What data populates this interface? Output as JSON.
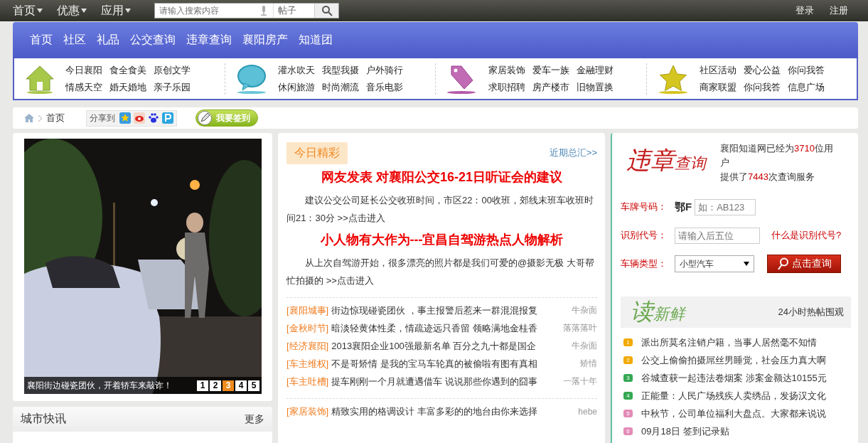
{
  "top_nav": [
    {
      "label": "首页"
    },
    {
      "label": "优惠"
    },
    {
      "label": "应用"
    }
  ],
  "search": {
    "placeholder": "请输入搜索内容",
    "scope": "帖子"
  },
  "account_links": [
    "登录",
    "注册"
  ],
  "main_nav": [
    "首页",
    "社区",
    "礼品",
    "公交查询",
    "违章查询",
    "襄阳房产",
    "知道团"
  ],
  "categories": [
    {
      "kind": "house",
      "links": [
        "今日襄阳",
        "食全食美",
        "原创文学",
        "情感天空",
        "婚天婚地",
        "亲子乐园"
      ]
    },
    {
      "kind": "bubble",
      "links": [
        "灌水吹天",
        "我型我摄",
        "户外骑行",
        "休闲旅游",
        "时尚潮流",
        "音乐电影"
      ]
    },
    {
      "kind": "tag",
      "links": [
        "家居装饰",
        "爱车一族",
        "金融理财",
        "求职招聘",
        "房产楼市",
        "旧物置换"
      ]
    },
    {
      "kind": "star",
      "links": [
        "社区活动",
        "爱心公益",
        "你问我答",
        "商家联盟",
        "你问我答",
        "信息广场"
      ]
    }
  ],
  "breadcrumb": [
    "首页"
  ],
  "share": {
    "label": "分享到"
  },
  "checkin_button": "我要签到",
  "slideshow": {
    "caption": "襄阳街边碰瓷团伙，开着轿车来敲诈！",
    "pages": [
      {
        "label": "1",
        "selected": false
      },
      {
        "label": "2",
        "selected": false
      },
      {
        "label": "3",
        "selected": true
      },
      {
        "label": "4",
        "selected": false
      },
      {
        "label": "5",
        "selected": false
      }
    ]
  },
  "city_news": {
    "title": "城市快讯",
    "more": "更多"
  },
  "today": {
    "tab": "今日精彩",
    "more": "近期总汇>>",
    "stories": [
      {
        "headline": "网友发表 对襄阳公交16-21日听证会的建议",
        "summary": "建议公交公司延长公交收班时间，市区22：00收班，郊线末班车收班时间21：30分",
        "link": ">>点击进入"
      },
      {
        "headline": "小人物有大作为---宜昌自驾游热点人物解析",
        "summary": "从上次自驾游开始，很多漂亮的照片都是我们可爱的@摄影无极 大哥帮忙拍摄的",
        "link": ">>点击进入"
      }
    ],
    "news_groups": [
      [
        {
          "tag": "[襄阳城事]",
          "title": "街边惊现碰瓷团伙 ，事主报警后惹来一群混混报复",
          "author": "牛杂面"
        },
        {
          "tag": "[金秋时节]",
          "title": "暗淡轻黄体性柔，情疏迹远只香留 领略满地金桂香",
          "author": "落落落叶"
        },
        {
          "tag": "[经济襄阳]",
          "title": "2013襄阳企业100强最新名单 百分之九十都是国企",
          "author": "牛杂面"
        },
        {
          "tag": "[车主维权]",
          "title": "不是哥矫情 是我的宝马车轮真的被偷啦有图有真相",
          "author": "矫情"
        },
        {
          "tag": "[车主吐槽]",
          "title": "提车刚刚一个月就遭遇借车 说说那些你遇到的囧事",
          "author": "一落十年"
        }
      ],
      [
        {
          "tag": "[家居装饰]",
          "title": "精致实用的格调设计 丰富多彩的的地台由你来选择",
          "author": "hebe"
        }
      ]
    ]
  },
  "violation_query": {
    "logo_big": "违章",
    "logo_small": "查询",
    "stats": [
      [
        {
          "text": "襄阳知道网已经为",
          "highlight": false
        },
        {
          "text": "3710",
          "highlight": true
        },
        {
          "text": "位用户",
          "highlight": false
        }
      ],
      [
        {
          "text": "提供了",
          "highlight": false
        },
        {
          "text": "7443",
          "highlight": true
        },
        {
          "text": "次查询服务",
          "highlight": false
        }
      ]
    ],
    "fields": [
      {
        "kind": "plate",
        "label": "车牌号码：",
        "prefix": "鄂F",
        "placeholder": "如：AB123"
      },
      {
        "kind": "code",
        "label": "识别代号：",
        "placeholder": "请输入后五位",
        "help_link": "什么是识别代号?"
      },
      {
        "kind": "select",
        "label": "车辆类型：",
        "value": "小型汽车",
        "button": "点击查询"
      }
    ]
  },
  "hot": {
    "logo_big": "读",
    "logo_small": "新鲜",
    "subtitle": "24小时热帖围观",
    "items": [
      {
        "rank": "1",
        "color": "#f2a900",
        "title": "派出所莫名注销户籍，当事人居然毫不知情"
      },
      {
        "rank": "2",
        "color": "#f2a900",
        "title": "公交上偷偷拍摄屌丝男睡觉，社会压力真大啊"
      },
      {
        "rank": "3",
        "color": "#34a853",
        "title": "谷城查获一起违法卷烟案 涉案金额达10155元"
      },
      {
        "rank": "4",
        "color": "#34a853",
        "title": "正能量：人民广场残疾人卖绣品，发扬汉文化"
      },
      {
        "rank": "5",
        "color": "#e48bb8",
        "title": "中秋节，公司单位福利大盘点。大家都来说说"
      },
      {
        "rank": "6",
        "color": "#e48bb8",
        "title": "09月18日 签到记录贴"
      }
    ]
  }
}
